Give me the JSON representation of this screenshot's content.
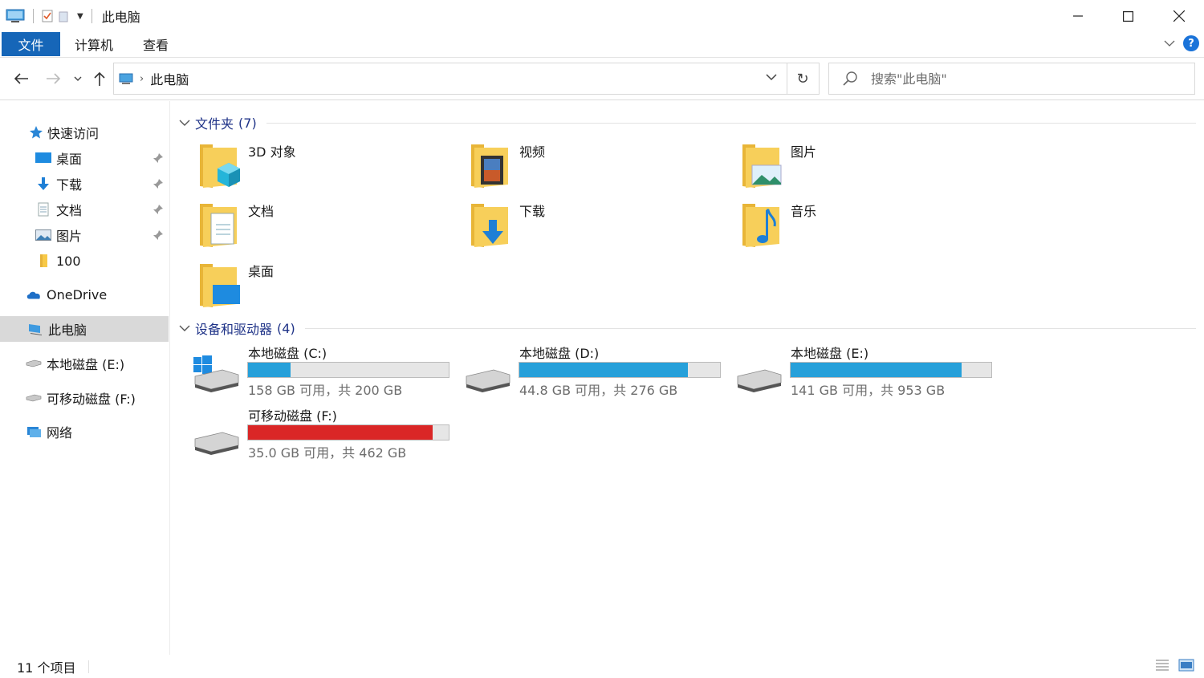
{
  "window": {
    "title": "此电脑"
  },
  "ribbon": {
    "tabs": [
      {
        "label": "文件"
      },
      {
        "label": "计算机"
      },
      {
        "label": "查看"
      }
    ]
  },
  "address": {
    "crumb": "此电脑"
  },
  "search": {
    "placeholder": "搜索\"此电脑\""
  },
  "sidebar": {
    "quick_access": "快速访问",
    "items": [
      {
        "label": "桌面",
        "pinned": true
      },
      {
        "label": "下载",
        "pinned": true
      },
      {
        "label": "文档",
        "pinned": true
      },
      {
        "label": "图片",
        "pinned": true
      },
      {
        "label": "100",
        "pinned": false
      }
    ],
    "onedrive": "OneDrive",
    "this_pc": "此电脑",
    "drive_e": "本地磁盘 (E:)",
    "drive_f": "可移动磁盘 (F:)",
    "network": "网络"
  },
  "folders_group": {
    "title": "文件夹",
    "count": "(7)",
    "items": [
      {
        "name": "3D 对象",
        "icon": "3d-objects-folder-icon"
      },
      {
        "name": "视频",
        "icon": "videos-folder-icon"
      },
      {
        "name": "图片",
        "icon": "pictures-folder-icon"
      },
      {
        "name": "文档",
        "icon": "documents-folder-icon"
      },
      {
        "name": "下载",
        "icon": "downloads-folder-icon"
      },
      {
        "name": "音乐",
        "icon": "music-folder-icon"
      },
      {
        "name": "桌面",
        "icon": "desktop-folder-icon"
      }
    ]
  },
  "drives_group": {
    "title": "设备和驱动器",
    "count": "(4)",
    "items": [
      {
        "name": "本地磁盘 (C:)",
        "info": "158 GB 可用，共 200 GB",
        "used_fraction": 0.21,
        "color": "#26a0da"
      },
      {
        "name": "本地磁盘 (D:)",
        "info": "44.8 GB 可用，共 276 GB",
        "used_fraction": 0.84,
        "color": "#26a0da"
      },
      {
        "name": "本地磁盘 (E:)",
        "info": "141 GB 可用，共 953 GB",
        "used_fraction": 0.85,
        "color": "#26a0da"
      },
      {
        "name": "可移动磁盘 (F:)",
        "info": "35.0 GB 可用，共 462 GB",
        "used_fraction": 0.92,
        "color": "#da2626"
      }
    ]
  },
  "status": {
    "count": "11 个项目"
  },
  "colors": {
    "accent": "#1666b8",
    "group_title": "#1e3287",
    "folder_yellow": "#f7c948"
  }
}
